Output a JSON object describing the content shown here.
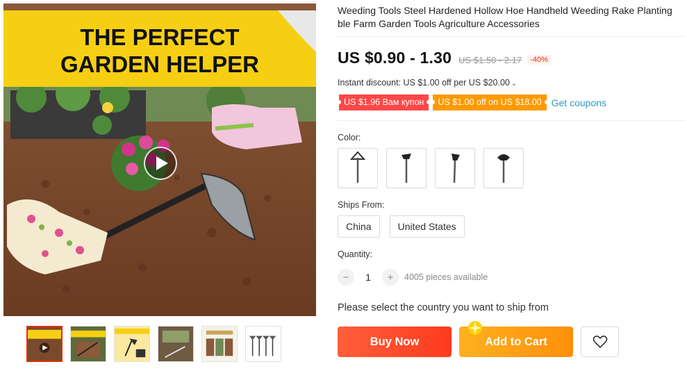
{
  "gallery": {
    "banner_line1": "THE PERFECT",
    "banner_line2": "GARDEN HELPER",
    "thumbnails": [
      {
        "icon": "video-thumbnail",
        "text": "THE PERFECT GARDEN HELPER"
      },
      {
        "icon": "product-thumbnail",
        "text": "HARDENED STEEL"
      },
      {
        "icon": "product-thumbnail",
        "text": ""
      },
      {
        "icon": "product-thumbnail",
        "text": ""
      },
      {
        "icon": "product-thumbnail",
        "text": ""
      },
      {
        "icon": "product-thumbnail",
        "text": ""
      }
    ]
  },
  "product": {
    "title": "Weeding Tools Steel Hardened Hollow Hoe Handheld Weeding Rake Planting ble Farm Garden Tools Agriculture Accessories",
    "price": "US $0.90 - 1.30",
    "old_price": "US $1.50 - 2.17",
    "discount": "-40%",
    "instant_discount": "Instant discount: US $1.00 off per US $20.00",
    "coupons": {
      "coupon1": "US $1.96 Вам купон",
      "coupon2": "US $1.00 off on US $18.00",
      "get_coupons": "Get coupons"
    }
  },
  "options": {
    "color_label": "Color:",
    "colors": [
      "hoe-style-1",
      "hoe-style-2",
      "hoe-style-3",
      "hoe-style-4"
    ],
    "ships_from_label": "Ships From:",
    "ships_from": [
      "China",
      "United States"
    ],
    "quantity_label": "Quantity:",
    "quantity": "1",
    "minus": "−",
    "plus": "+",
    "available": "4005 pieces available"
  },
  "ship_message": "Please select the country you want to ship from",
  "actions": {
    "buy_now": "Buy Now",
    "add_to_cart": "Add to Cart"
  },
  "colors": {
    "accent_red": "#ff4747",
    "accent_orange": "#ff9900",
    "link_blue": "#2e9cc3"
  }
}
